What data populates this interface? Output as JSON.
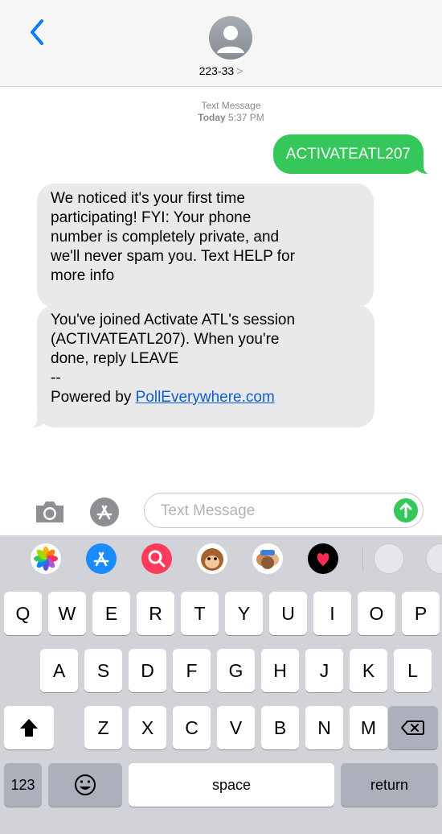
{
  "header": {
    "back_icon": "chevron-left-icon",
    "avatar_icon": "person-icon",
    "contact": "223-33",
    "contact_chevron": ">"
  },
  "thread": {
    "label": "Text Message",
    "day": "Today",
    "time": "5:37 PM"
  },
  "messages": [
    {
      "direction": "outgoing",
      "text": "ACTIVATEATL207"
    },
    {
      "direction": "incoming",
      "lines": [
        "We noticed it's your first time",
        "participating! FYI: Your phone",
        "number is completely private, and",
        "we'll never spam you. Text HELP for",
        "more info"
      ]
    },
    {
      "direction": "incoming",
      "lines": [
        "You've joined Activate ATL's session",
        "(ACTIVATEATL207). When you're",
        "done, reply LEAVE",
        "--"
      ],
      "powered_prefix": "Powered by ",
      "link": "PollEverywhere.com"
    }
  ],
  "composer": {
    "camera_icon": "camera-icon",
    "appstore_icon": "app-store-icon",
    "placeholder": "Text Message",
    "send_icon": "arrow-up-icon"
  },
  "app_drawer": [
    "photos-icon",
    "app-store-icon",
    "search-images-icon",
    "animoji-icon",
    "memoji-icon",
    "digital-touch-icon",
    "sticker-icon",
    "sticker-icon"
  ],
  "keyboard": {
    "row1": [
      "Q",
      "W",
      "E",
      "R",
      "T",
      "Y",
      "U",
      "I",
      "O",
      "P"
    ],
    "row2": [
      "A",
      "S",
      "D",
      "F",
      "G",
      "H",
      "J",
      "K",
      "L"
    ],
    "row3": [
      "Z",
      "X",
      "C",
      "V",
      "B",
      "N",
      "M"
    ],
    "numbers": "123",
    "space": "space",
    "return": "return"
  },
  "colors": {
    "accent": "#0a7aff",
    "sent_bubble": "#35c759",
    "received_bubble": "#e9e9eb",
    "keyboard_bg": "#d1d3d9"
  }
}
